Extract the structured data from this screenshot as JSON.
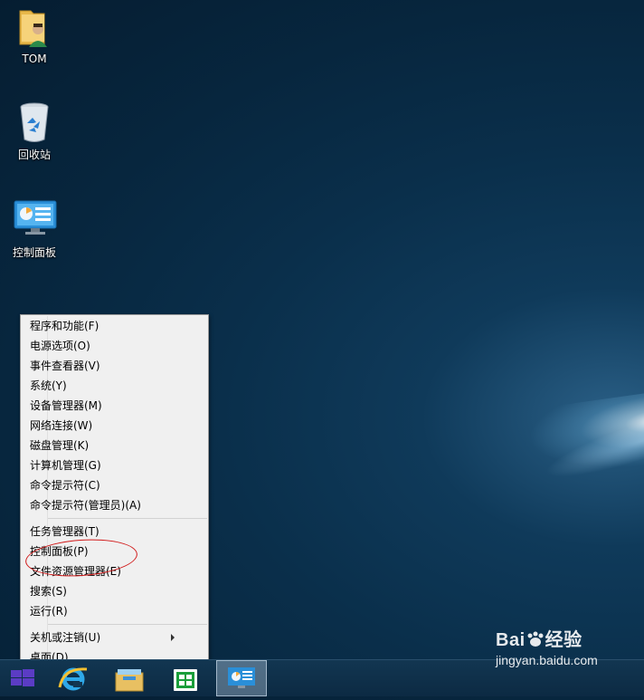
{
  "desktop": {
    "icons": [
      {
        "label": "TOM"
      },
      {
        "label": "回收站"
      },
      {
        "label": "控制面板"
      }
    ]
  },
  "context_menu": {
    "group1": [
      "程序和功能(F)",
      "电源选项(O)",
      "事件查看器(V)",
      "系统(Y)",
      "设备管理器(M)",
      "网络连接(W)",
      "磁盘管理(K)",
      "计算机管理(G)",
      "命令提示符(C)",
      "命令提示符(管理员)(A)"
    ],
    "group2": [
      "任务管理器(T)",
      "控制面板(P)",
      "文件资源管理器(E)",
      "搜索(S)",
      "运行(R)"
    ],
    "group3": [
      "关机或注销(U)",
      "桌面(D)"
    ],
    "highlight_color": "#d11a1a"
  },
  "taskbar": {
    "items": [
      "start-button",
      "internet-explorer-icon",
      "file-explorer-icon",
      "store-icon",
      "control-panel-icon"
    ],
    "active_item": "control-panel-icon"
  },
  "watermark": {
    "brand": "Bai",
    "brand_cn": "经验",
    "url": "jingyan.baidu.com"
  }
}
